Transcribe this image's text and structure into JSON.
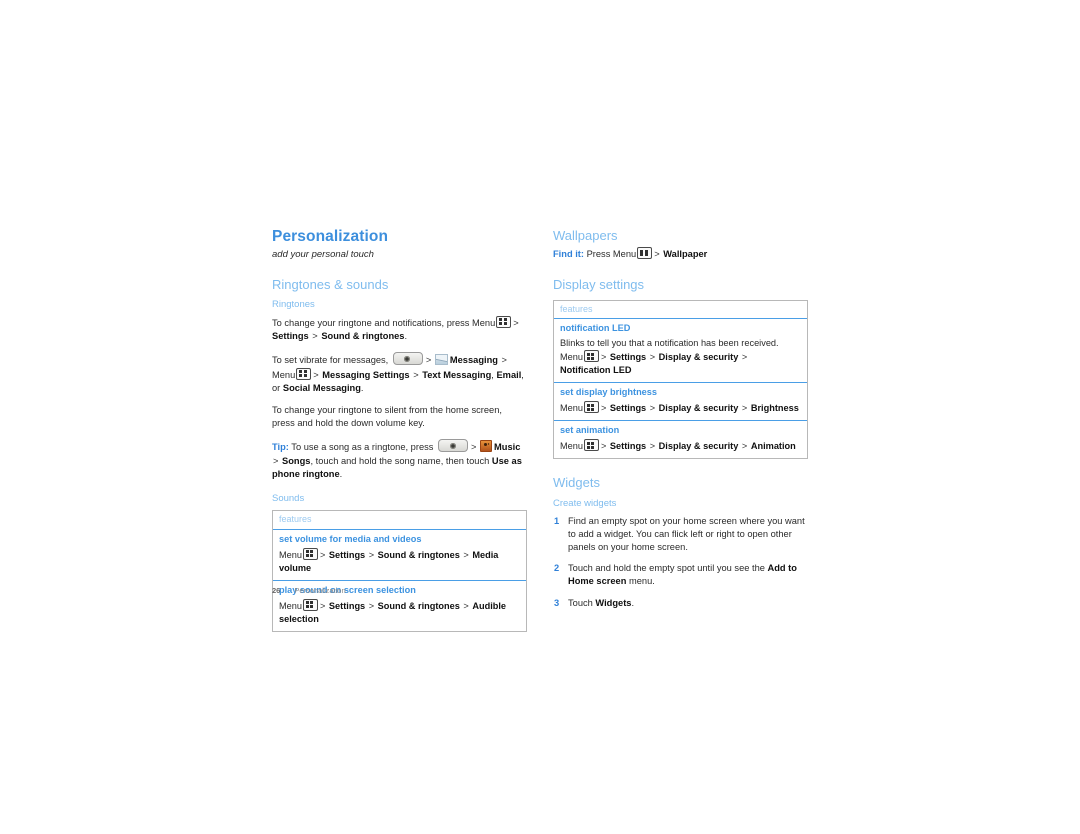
{
  "page": {
    "number": "26",
    "footer_label": "Personalization"
  },
  "chapter": {
    "title": "Personalization",
    "subtitle": "add your personal touch"
  },
  "left_column": {
    "section_title": "Ringtones & sounds",
    "sub_title": "Ringtones",
    "paragraphs": {
      "p1_a": "To change your ringtone and notifications, press Menu",
      "p1_b": ">",
      "p1_c": "Settings",
      "p1_d": ">",
      "p1_e": "Sound & ringtones",
      "p1_f": ".",
      "p2_a": "To set vibrate for messages,",
      "p2_b": ">",
      "p2_c": "Messaging",
      "p2_d": ">",
      "p2_e": "Menu",
      "p2_f": ">",
      "p2_g": "Messaging Settings",
      "p2_h": ">",
      "p2_i": "Text Messaging",
      "p2_j": ",",
      "p2_k": "Email",
      "p2_l": ", or",
      "p2_m": "Social Messaging",
      "p2_n": ".",
      "p3": "To change your ringtone to silent from the home screen, press and hold the down volume key.",
      "tip_label": "Tip:",
      "tip_a": "To use a song as a ringtone, press",
      "tip_b": ">",
      "tip_c": "Music",
      "tip_d": ">",
      "tip_e": "Songs",
      "tip_f": ", touch and hold the song name, then touch",
      "tip_g": "Use as phone ringtone",
      "tip_h": "."
    },
    "sounds_sub_title": "Sounds",
    "table": {
      "header": "features",
      "rows": [
        {
          "name": "set volume for media and videos",
          "d_a": "Menu",
          "d_b": ">",
          "d_c": "Settings",
          "d_d": ">",
          "d_e": "Sound & ringtones",
          "d_f": ">",
          "d_g": "Media volume"
        },
        {
          "name": "play sound on screen selection",
          "d_a": "Menu",
          "d_b": ">",
          "d_c": "Settings",
          "d_d": ">",
          "d_e": "Sound & ringtones",
          "d_f": ">",
          "d_g": "Audible selection"
        }
      ]
    }
  },
  "right_column": {
    "wallpapers": {
      "section_title": "Wallpapers",
      "findit_label": "Find it:",
      "findit_a": "Press Menu",
      "findit_b": ">",
      "findit_c": "Wallpaper"
    },
    "display_settings": {
      "section_title": "Display settings",
      "table": {
        "header": "features",
        "rows": [
          {
            "name": "notification LED",
            "d_a": "Blinks to tell you that a notification has been received. Menu",
            "d_b": ">",
            "d_c": "Settings",
            "d_d": ">",
            "d_e": "Display & security",
            "d_f": ">",
            "d_g": "Notification LED"
          },
          {
            "name": "set display brightness",
            "d_a": "Menu",
            "d_b": ">",
            "d_c": "Settings",
            "d_d": ">",
            "d_e": "Display & security",
            "d_f": ">",
            "d_g": "Brightness"
          },
          {
            "name": "set animation",
            "d_a": "Menu",
            "d_b": ">",
            "d_c": "Settings",
            "d_d": ">",
            "d_e": "Display & security",
            "d_f": ">",
            "d_g": "Animation"
          }
        ]
      }
    },
    "widgets": {
      "section_title": "Widgets",
      "sub_title": "Create widgets",
      "steps": [
        {
          "num": "1",
          "text_a": "Find an empty spot on your home screen where you want to add a widget. You can flick left or right to open other panels on your home screen.",
          "bold": "",
          "text_b": ""
        },
        {
          "num": "2",
          "text_a": "Touch and hold the empty spot until you see the",
          "bold": "Add to Home screen",
          "text_b": "menu."
        },
        {
          "num": "3",
          "text_a": "Touch",
          "bold": "Widgets",
          "text_b": "."
        }
      ]
    }
  },
  "icons": {
    "menu_key": "menu-key-icon",
    "home_key": "home-key-icon",
    "messaging": "messaging-icon",
    "music": "music-icon"
  }
}
